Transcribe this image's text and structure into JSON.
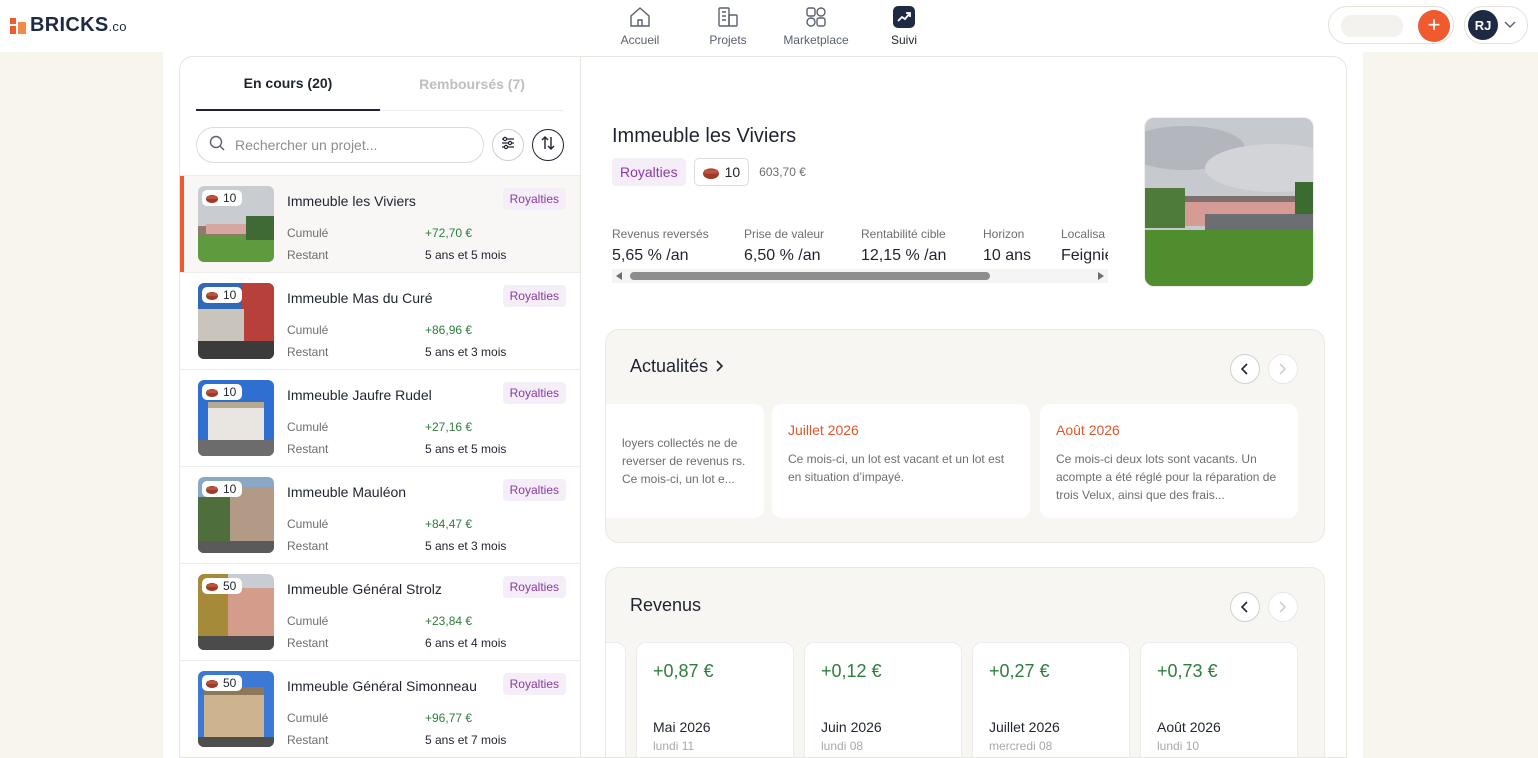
{
  "brand": {
    "name": "BRICKS",
    "suffix": ".co"
  },
  "nav": [
    {
      "label": "Accueil"
    },
    {
      "label": "Projets"
    },
    {
      "label": "Marketplace"
    },
    {
      "label": "Suivi"
    }
  ],
  "user": {
    "initials": "RJ"
  },
  "tabs": {
    "current": "En cours (20)",
    "repaid": "Remboursés (7)"
  },
  "search": {
    "placeholder": "Rechercher un projet..."
  },
  "list_labels": {
    "cumul": "Cumulé",
    "remaining": "Restant"
  },
  "projects": [
    {
      "title": "Immeuble les Viviers",
      "bricks": "10",
      "tag": "Royalties",
      "cumul": "+72,70 €",
      "remaining": "5 ans et 5 mois"
    },
    {
      "title": "Immeuble Mas du Curé",
      "bricks": "10",
      "tag": "Royalties",
      "cumul": "+86,96 €",
      "remaining": "5 ans et 3 mois"
    },
    {
      "title": "Immeuble Jaufre Rudel",
      "bricks": "10",
      "tag": "Royalties",
      "cumul": "+27,16 €",
      "remaining": "5 ans et 5 mois"
    },
    {
      "title": "Immeuble Mauléon",
      "bricks": "10",
      "tag": "Royalties",
      "cumul": "+84,47 €",
      "remaining": "5 ans et 3 mois"
    },
    {
      "title": "Immeuble Général Strolz",
      "bricks": "50",
      "tag": "Royalties",
      "cumul": "+23,84 €",
      "remaining": "6 ans et 4 mois"
    },
    {
      "title": "Immeuble Général Simonneau",
      "bricks": "50",
      "tag": "Royalties",
      "cumul": "+96,77 €",
      "remaining": "5 ans et 7 mois"
    }
  ],
  "detail": {
    "title": "Immeuble les Viviers",
    "tag": "Royalties",
    "bricks": "10",
    "amount": "603,70 €",
    "stats": [
      {
        "label": "Revenus reversés",
        "value": "5,65 % /an"
      },
      {
        "label": "Prise de valeur",
        "value": "6,50 % /an"
      },
      {
        "label": "Rentabilité cible",
        "value": "12,15 % /an"
      },
      {
        "label": "Horizon",
        "value": "10 ans"
      },
      {
        "label": "Localisa",
        "value": "Feignie"
      }
    ]
  },
  "news": {
    "title": "Actualités",
    "items": [
      {
        "title": "",
        "body": "loyers collectés ne de reverser de revenus rs. Ce mois-ci, un lot e..."
      },
      {
        "title": "Juillet 2026",
        "body": "Ce mois-ci, un lot est vacant et un lot est en situation d’impayé."
      },
      {
        "title": "Août 2026",
        "body": "Ce mois-ci deux lots sont vacants. Un acompte a été réglé pour la réparation de trois Velux, ainsi que des frais..."
      }
    ]
  },
  "revenus": {
    "title": "Revenus",
    "items": [
      {
        "amount": "+0,87 €",
        "month": "Mai 2026",
        "day": "lundi 11"
      },
      {
        "amount": "+0,12 €",
        "month": "Juin 2026",
        "day": "lundi 08"
      },
      {
        "amount": "+0,27 €",
        "month": "Juillet 2026",
        "day": "mercredi 08"
      },
      {
        "amount": "+0,73 €",
        "month": "Août 2026",
        "day": "lundi 10"
      }
    ]
  },
  "colors": {
    "accent": "#ef5a2e",
    "navy": "#1e2a44",
    "green": "#2f7d3c",
    "purple": "#8a3aa3"
  }
}
